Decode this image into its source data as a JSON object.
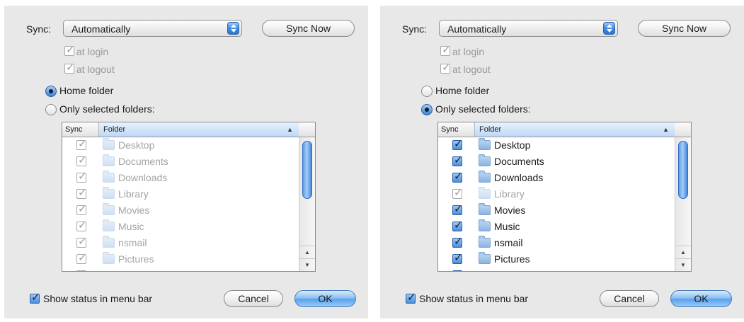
{
  "panels": [
    {
      "sync_label": "Sync:",
      "sync_value": "Automatically",
      "sync_now": "Sync Now",
      "at_login": "at login",
      "at_logout": "at logout",
      "home_folder": "Home folder",
      "only_selected": "Only selected folders:",
      "selected_option": "home",
      "table": {
        "col_sync": "Sync",
        "col_folder": "Folder",
        "sort_indicator": "▲",
        "rows": [
          {
            "name": "Desktop",
            "checked": true,
            "enabled": false
          },
          {
            "name": "Documents",
            "checked": true,
            "enabled": false
          },
          {
            "name": "Downloads",
            "checked": true,
            "enabled": false
          },
          {
            "name": "Library",
            "checked": true,
            "enabled": false
          },
          {
            "name": "Movies",
            "checked": true,
            "enabled": false
          },
          {
            "name": "Music",
            "checked": true,
            "enabled": false
          },
          {
            "name": "nsmail",
            "checked": true,
            "enabled": false
          },
          {
            "name": "Pictures",
            "checked": true,
            "enabled": false
          },
          {
            "name": "",
            "checked": true,
            "enabled": false
          }
        ]
      },
      "show_status": "Show status in menu bar",
      "cancel": "Cancel",
      "ok": "OK"
    },
    {
      "sync_label": "Sync:",
      "sync_value": "Automatically",
      "sync_now": "Sync Now",
      "at_login": "at login",
      "at_logout": "at logout",
      "home_folder": "Home folder",
      "only_selected": "Only selected folders:",
      "selected_option": "selected",
      "table": {
        "col_sync": "Sync",
        "col_folder": "Folder",
        "sort_indicator": "▲",
        "rows": [
          {
            "name": "Desktop",
            "checked": true,
            "enabled": true
          },
          {
            "name": "Documents",
            "checked": true,
            "enabled": true
          },
          {
            "name": "Downloads",
            "checked": true,
            "enabled": true
          },
          {
            "name": "Library",
            "checked": true,
            "enabled": false
          },
          {
            "name": "Movies",
            "checked": true,
            "enabled": true
          },
          {
            "name": "Music",
            "checked": true,
            "enabled": true
          },
          {
            "name": "nsmail",
            "checked": true,
            "enabled": true
          },
          {
            "name": "Pictures",
            "checked": true,
            "enabled": true
          },
          {
            "name": "",
            "checked": true,
            "enabled": true
          }
        ]
      },
      "show_status": "Show status in menu bar",
      "cancel": "Cancel",
      "ok": "OK"
    }
  ],
  "scroll_up_glyph": "▲",
  "scroll_down_glyph": "▼",
  "colors": {
    "accent": "#3f8be0",
    "panel_bg": "#e8e8e8"
  }
}
